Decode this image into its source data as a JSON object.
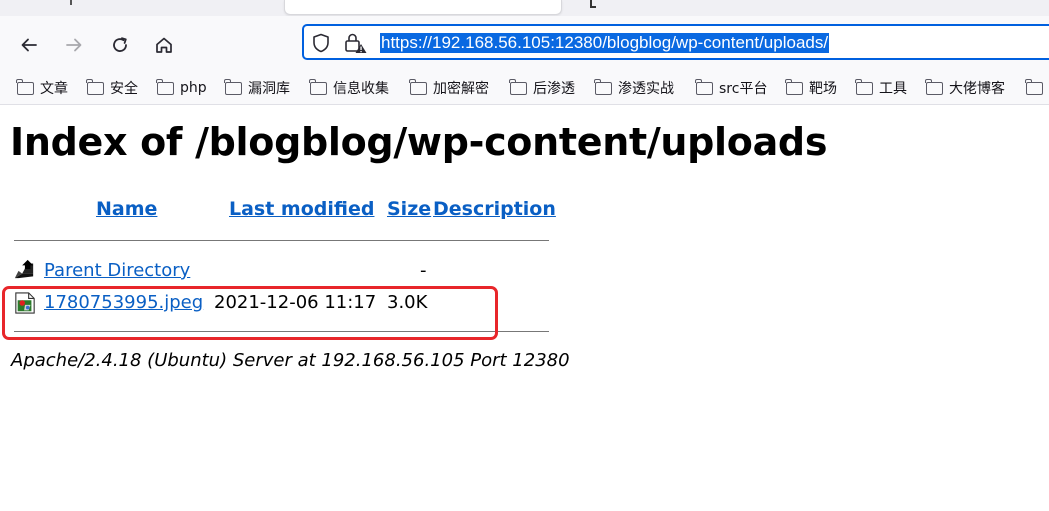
{
  "browser": {
    "url": "https://192.168.56.105:12380/blogblog/wp-content/uploads/",
    "bookmarks": [
      "文章",
      "安全",
      "php",
      "漏洞库",
      "信息收集",
      "加密解密",
      "后渗透",
      "渗透实战",
      "src平台",
      "靶场",
      "工具",
      "大佬博客"
    ]
  },
  "page": {
    "title": "Index of /blogblog/wp-content/uploads",
    "columns": [
      "Name",
      "Last modified",
      "Size",
      "Description"
    ],
    "rows": [
      {
        "name": "Parent Directory",
        "modified": "",
        "size": "-",
        "description": "",
        "icon": "back-folder-icon"
      },
      {
        "name": "1780753995.jpeg",
        "modified": "2021-12-06 11:17",
        "size": "3.0K",
        "description": "",
        "icon": "image-file-icon"
      }
    ],
    "footer": "Apache/2.4.18 (Ubuntu) Server at 192.168.56.105 Port 12380"
  },
  "annotation_color": "#e8262a",
  "accent_color": "#0060df"
}
